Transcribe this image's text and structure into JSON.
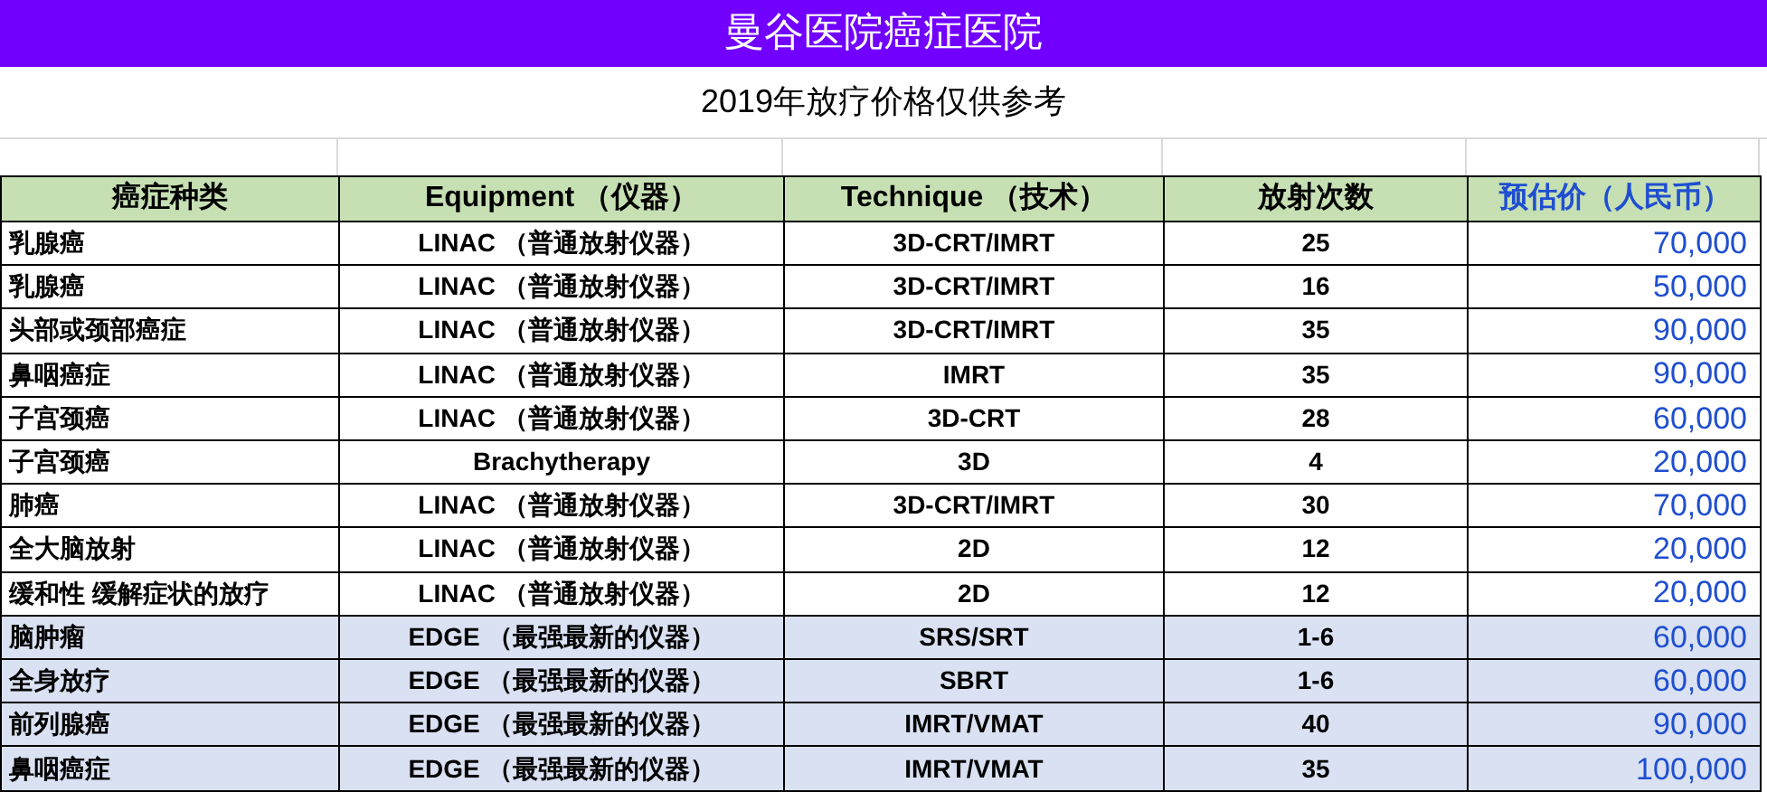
{
  "title": "曼谷医院癌症医院",
  "subtitle": "2019年放疗价格仅供参考",
  "table": {
    "columns": [
      "癌症种类",
      "Equipment （仪器）",
      "Technique （技术）",
      "放射次数",
      "预估价（人民币）"
    ],
    "rows": [
      {
        "shaded": false,
        "cells": [
          "乳腺癌",
          "LINAC （普通放射仪器）",
          "3D-CRT/IMRT",
          "25",
          "70,000"
        ]
      },
      {
        "shaded": false,
        "cells": [
          "乳腺癌",
          "LINAC （普通放射仪器）",
          "3D-CRT/IMRT",
          "16",
          "50,000"
        ]
      },
      {
        "shaded": false,
        "cells": [
          "头部或颈部癌症",
          "LINAC （普通放射仪器）",
          "3D-CRT/IMRT",
          "35",
          "90,000"
        ]
      },
      {
        "shaded": false,
        "cells": [
          "鼻咽癌症",
          "LINAC （普通放射仪器）",
          "IMRT",
          "35",
          "90,000"
        ]
      },
      {
        "shaded": false,
        "cells": [
          "子宫颈癌",
          "LINAC （普通放射仪器）",
          "3D-CRT",
          "28",
          "60,000"
        ]
      },
      {
        "shaded": false,
        "cells": [
          "子宫颈癌",
          "Brachytherapy",
          "3D",
          "4",
          "20,000"
        ]
      },
      {
        "shaded": false,
        "cells": [
          "肺癌",
          "LINAC （普通放射仪器）",
          "3D-CRT/IMRT",
          "30",
          "70,000"
        ]
      },
      {
        "shaded": false,
        "cells": [
          "全大脑放射",
          "LINAC （普通放射仪器）",
          "2D",
          "12",
          "20,000"
        ]
      },
      {
        "shaded": false,
        "cells": [
          "缓和性 缓解症状的放疗",
          "LINAC （普通放射仪器）",
          "2D",
          "12",
          "20,000"
        ]
      },
      {
        "shaded": true,
        "cells": [
          "脑肿瘤",
          "EDGE （最强最新的仪器）",
          "SRS/SRT",
          "1-6",
          "60,000"
        ]
      },
      {
        "shaded": true,
        "cells": [
          "全身放疗",
          "EDGE （最强最新的仪器）",
          "SBRT",
          "1-6",
          "60,000"
        ]
      },
      {
        "shaded": true,
        "cells": [
          "前列腺癌",
          "EDGE （最强最新的仪器）",
          "IMRT/VMAT",
          "40",
          "90,000"
        ]
      },
      {
        "shaded": true,
        "cells": [
          "鼻咽癌症",
          "EDGE （最强最新的仪器）",
          "IMRT/VMAT",
          "35",
          "100,000"
        ]
      }
    ]
  }
}
